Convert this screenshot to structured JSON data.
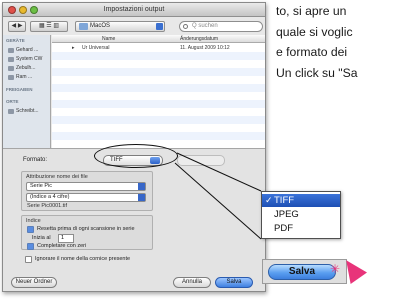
{
  "dialog": {
    "title": "Impostazioni output",
    "path_folder": "MacOS",
    "search_placeholder": "Q suchen",
    "sidebar": {
      "section_devices": "GERÄTE",
      "devices": [
        "Gehard ...",
        "System CW",
        "Zebulh...",
        "Ram   ..."
      ],
      "section_shared": "FREIGABEN",
      "section_places": "ORTE",
      "places": [
        "Schreibt..."
      ]
    },
    "columns": {
      "name": "Name",
      "modified": "Änderungsdatum"
    },
    "files": [
      {
        "name": "Ur Universal",
        "modified": "11. August 2009 10:12"
      }
    ],
    "format_label": "Formato:",
    "format_value": "TIFF",
    "naming_group": "Attribuzione nome dei file",
    "naming_pop1": "Serie Pic",
    "naming_pop2": "(Indice a 4 cifre)",
    "naming_example": "Serie Pic0001.tif",
    "index_group": "Indice",
    "index_opt1": "Resetta prima di ogni scansione in serie",
    "index_start_label": "Inizia al",
    "index_start_value": "1",
    "index_opt2": "Completare con zeri",
    "ignore_label": "Ignorare il nome della cornice presente",
    "new_folder": "Neuer Ordner",
    "cancel": "Annulla",
    "save": "Salva"
  },
  "menu": {
    "check": "✓",
    "items": [
      "TIFF",
      "JPEG",
      "PDF"
    ],
    "selected": "TIFF"
  },
  "paragraph": {
    "line1": "to, si apre un",
    "line2": "quale si voglic",
    "line3": "e formato dei",
    "line4": "Un click su \"Sa"
  },
  "zoom_save": "Salva",
  "colors": {
    "accent": "#2c62c9",
    "cursor": "#e8347a"
  }
}
